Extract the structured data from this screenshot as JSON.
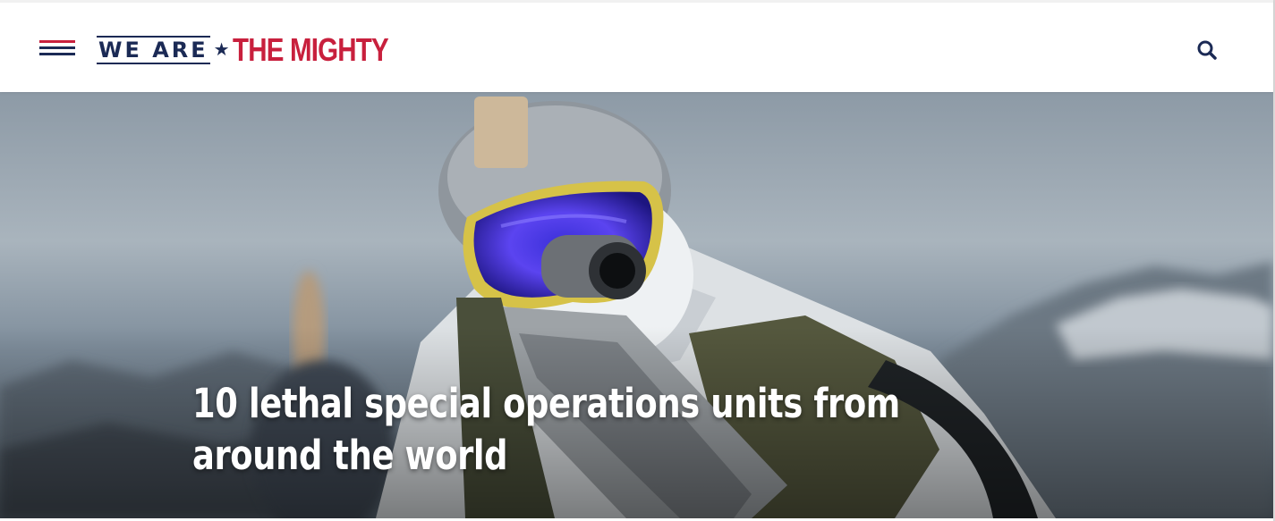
{
  "header": {
    "logo": {
      "part1": "WE ARE",
      "star": "★",
      "part2": "THE MIGHTY"
    },
    "menu_icon": "hamburger-menu-icon",
    "search_icon": "search-icon"
  },
  "hero": {
    "title": "10 lethal special operations units from around the world",
    "image_subject": "soldier-with-rifle-and-goggles"
  },
  "colors": {
    "brand_navy": "#1b2a55",
    "brand_red": "#c8203d",
    "header_bg": "#ffffff",
    "title_text": "#ffffff"
  }
}
